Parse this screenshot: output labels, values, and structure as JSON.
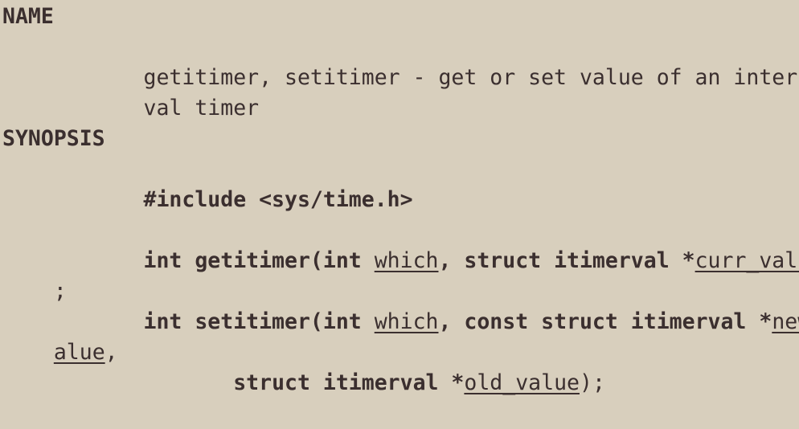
{
  "man": {
    "name_header": "NAME",
    "name_line1": "getitimer, setitimer - get or set value of an inter-",
    "name_line2": "val timer",
    "synopsis_header": "SYNOPSIS",
    "include": "#include <sys/time.h>",
    "get_prefix": "int getitimer(int ",
    "get_which": "which",
    "get_mid": ", struct itimerval *",
    "get_arg": "curr_value",
    "get_close": ")",
    "get_cont": ";",
    "set_prefix": "int setitimer(int ",
    "set_which": "which",
    "set_mid": ", const struct itimerval *",
    "set_arg_part1": "new_v",
    "set_arg_part2": "alue",
    "set_arg_tail": ",",
    "set_line3_prefix": "struct itimerval *",
    "set_old": "old_value",
    "set_close": ");"
  }
}
